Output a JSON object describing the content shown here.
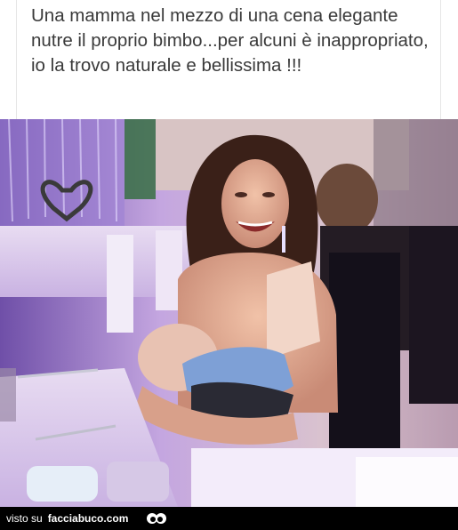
{
  "caption": {
    "text": "Una mamma nel mezzo di una cena elegante nutre il proprio bimbo...per alcuni è inappropriato, io la trovo naturale e bellissima !!!"
  },
  "photo": {
    "description_icon": "restaurant-photo"
  },
  "footer": {
    "prefix": "visto su",
    "site": "facciabuco.com",
    "logo_icon": "eyes-icon"
  }
}
